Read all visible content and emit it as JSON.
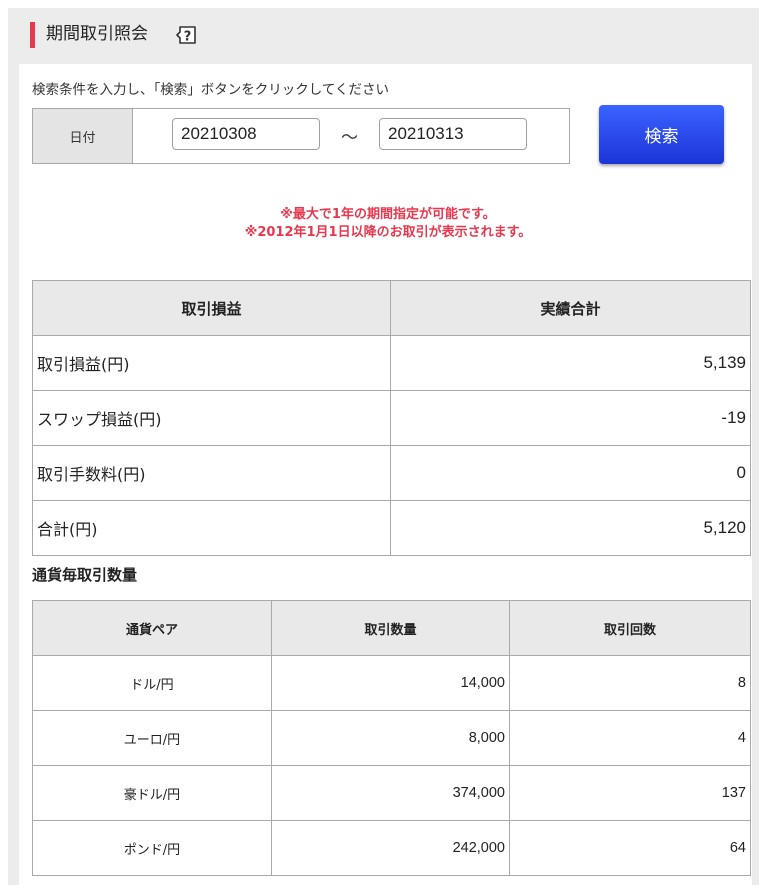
{
  "header": {
    "title": "期間取引照会",
    "help_icon": "question-mark-icon"
  },
  "search": {
    "instruction": "検索条件を入力し、「検索」ボタンをクリックしてください",
    "date_label": "日付",
    "date_from": "20210308",
    "separator": "～",
    "date_to": "20210313",
    "button_label": "検索"
  },
  "notices": [
    "※最大で1年の期間指定が可能です。",
    "※2012年1月1日以降のお取引が表示されます。"
  ],
  "summary": {
    "headers": [
      "取引損益",
      "実績合計"
    ],
    "rows": [
      {
        "label": "取引損益(円)",
        "value": "5,139"
      },
      {
        "label": "スワップ損益(円)",
        "value": "-19"
      },
      {
        "label": "取引手数料(円)",
        "value": "0"
      },
      {
        "label": "合計(円)",
        "value": "5,120"
      }
    ]
  },
  "pairs": {
    "title": "通貨毎取引数量",
    "headers": [
      "通貨ペア",
      "取引数量",
      "取引回数"
    ],
    "rows": [
      {
        "pair": "ドル/円",
        "quantity": "14,000",
        "count": "8"
      },
      {
        "pair": "ユーロ/円",
        "quantity": "8,000",
        "count": "4"
      },
      {
        "pair": "豪ドル/円",
        "quantity": "374,000",
        "count": "137"
      },
      {
        "pair": "ポンド/円",
        "quantity": "242,000",
        "count": "64"
      }
    ]
  },
  "colors": {
    "accent": "#e8384f",
    "button": "#2441e6"
  }
}
